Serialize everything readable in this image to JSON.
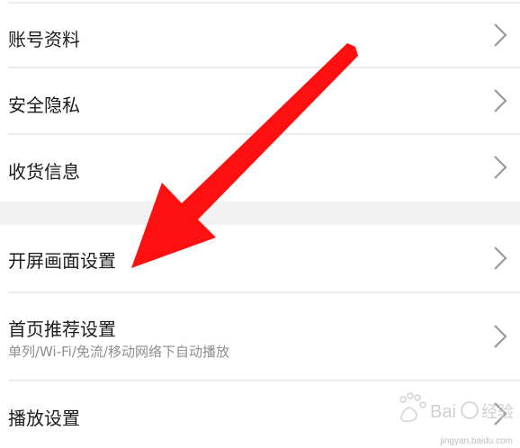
{
  "settings": {
    "group1": [
      {
        "label": "账号资料"
      },
      {
        "label": "安全隐私"
      },
      {
        "label": "收货信息"
      }
    ],
    "group2": [
      {
        "label": "开屏画面设置"
      },
      {
        "label": "首页推荐设置",
        "sub": "单列/Wi-Fi/免流/移动网络下自动播放"
      },
      {
        "label": "播放设置"
      }
    ]
  },
  "icons": {
    "chevron": "chevron-right-icon",
    "arrow": "red-arrow-annotation"
  },
  "watermark": {
    "url": "jingyan.baidu.com"
  },
  "colors": {
    "arrow": "#ff1010",
    "divider": "#ececec",
    "section_gap": "#f1f1f1",
    "label": "#1c1c1c",
    "sub_label": "#8e8e8e",
    "chevron": "#9a9a9a"
  }
}
